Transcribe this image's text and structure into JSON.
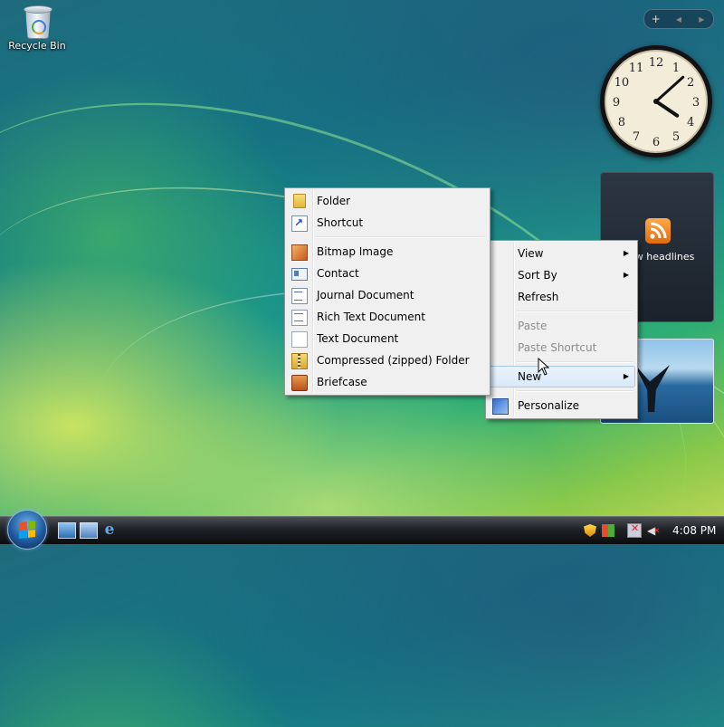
{
  "desktop": {
    "icons": [
      {
        "label": "Recycle Bin",
        "icon": "recycle-bin-icon"
      }
    ]
  },
  "gadgets": {
    "controls": {
      "add": "+",
      "prev": "◂",
      "next": "▸"
    },
    "clock": {
      "hour": 4,
      "minute": 8,
      "numbers": [
        "12",
        "1",
        "2",
        "3",
        "4",
        "5",
        "6",
        "7",
        "8",
        "9",
        "10",
        "11"
      ]
    },
    "feed_headlines": {
      "label": "View headlines"
    },
    "slideshow": {
      "subject": "whale tail"
    }
  },
  "context_menu": {
    "items": [
      {
        "label": "View",
        "submenu": true
      },
      {
        "label": "Sort By",
        "submenu": true
      },
      {
        "label": "Refresh"
      },
      {
        "label": "Paste",
        "disabled": true
      },
      {
        "label": "Paste Shortcut",
        "disabled": true
      },
      {
        "label": "New",
        "submenu": true,
        "highlighted": true
      },
      {
        "label": "Personalize",
        "icon": "personalize-icon"
      }
    ]
  },
  "new_submenu": {
    "items": [
      {
        "label": "Folder",
        "icon": "folder-icon"
      },
      {
        "label": "Shortcut",
        "icon": "shortcut-icon"
      },
      {
        "label": "Bitmap Image",
        "icon": "bitmap-image-icon"
      },
      {
        "label": "Contact",
        "icon": "contact-icon"
      },
      {
        "label": "Journal Document",
        "icon": "journal-document-icon"
      },
      {
        "label": "Rich Text Document",
        "icon": "rich-text-document-icon"
      },
      {
        "label": "Text Document",
        "icon": "text-document-icon"
      },
      {
        "label": "Compressed (zipped) Folder",
        "icon": "zip-folder-icon"
      },
      {
        "label": "Briefcase",
        "icon": "briefcase-icon"
      }
    ]
  },
  "taskbar": {
    "time": "4:08 PM",
    "quick_launch": [
      "show-desktop-icon",
      "switch-windows-icon",
      "internet-explorer-icon"
    ],
    "tray": [
      "security-shield-icon",
      "windows-update-icon",
      "network-disconnected-icon",
      "volume-muted-icon"
    ]
  },
  "colors": {
    "accent": "#1d5aa0",
    "menu_bg": "#f0f0f0",
    "highlight": "#d9e9f9"
  }
}
